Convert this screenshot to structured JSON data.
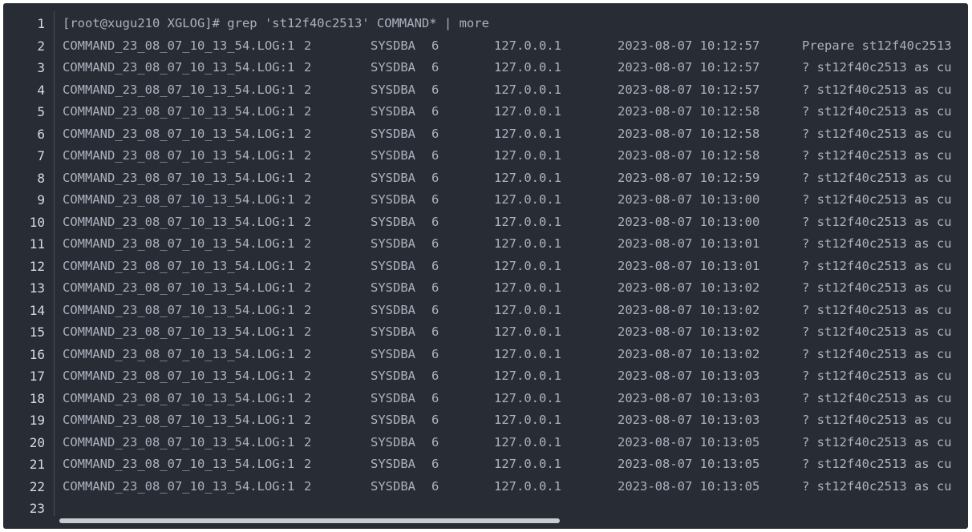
{
  "terminal": {
    "command": "[root@xugu210 XGLOG]# grep 'st12f40c2513' COMMAND* | more",
    "line_numbers": [
      "1",
      "2",
      "3",
      "4",
      "5",
      "6",
      "7",
      "8",
      "9",
      "10",
      "11",
      "12",
      "13",
      "14",
      "15",
      "16",
      "17",
      "18",
      "19",
      "20",
      "21",
      "22",
      "23"
    ],
    "rows": [
      {
        "file": "COMMAND_23_08_07_10_13_54.LOG:1",
        "num": "2",
        "user": "SYSDBA",
        "sess": "6",
        "ip": "127.0.0.1",
        "time": "2023-08-07 10:12:57",
        "sql": "Prepare st12f40c2513"
      },
      {
        "file": "COMMAND_23_08_07_10_13_54.LOG:1",
        "num": "2",
        "user": "SYSDBA",
        "sess": "6",
        "ip": "127.0.0.1",
        "time": "2023-08-07 10:12:57",
        "sql": "? st12f40c2513 as cu"
      },
      {
        "file": "COMMAND_23_08_07_10_13_54.LOG:1",
        "num": "2",
        "user": "SYSDBA",
        "sess": "6",
        "ip": "127.0.0.1",
        "time": "2023-08-07 10:12:57",
        "sql": "? st12f40c2513 as cu"
      },
      {
        "file": "COMMAND_23_08_07_10_13_54.LOG:1",
        "num": "2",
        "user": "SYSDBA",
        "sess": "6",
        "ip": "127.0.0.1",
        "time": "2023-08-07 10:12:58",
        "sql": "? st12f40c2513 as cu"
      },
      {
        "file": "COMMAND_23_08_07_10_13_54.LOG:1",
        "num": "2",
        "user": "SYSDBA",
        "sess": "6",
        "ip": "127.0.0.1",
        "time": "2023-08-07 10:12:58",
        "sql": "? st12f40c2513 as cu"
      },
      {
        "file": "COMMAND_23_08_07_10_13_54.LOG:1",
        "num": "2",
        "user": "SYSDBA",
        "sess": "6",
        "ip": "127.0.0.1",
        "time": "2023-08-07 10:12:58",
        "sql": "? st12f40c2513 as cu"
      },
      {
        "file": "COMMAND_23_08_07_10_13_54.LOG:1",
        "num": "2",
        "user": "SYSDBA",
        "sess": "6",
        "ip": "127.0.0.1",
        "time": "2023-08-07 10:12:59",
        "sql": "? st12f40c2513 as cu"
      },
      {
        "file": "COMMAND_23_08_07_10_13_54.LOG:1",
        "num": "2",
        "user": "SYSDBA",
        "sess": "6",
        "ip": "127.0.0.1",
        "time": "2023-08-07 10:13:00",
        "sql": "? st12f40c2513 as cu"
      },
      {
        "file": "COMMAND_23_08_07_10_13_54.LOG:1",
        "num": "2",
        "user": "SYSDBA",
        "sess": "6",
        "ip": "127.0.0.1",
        "time": "2023-08-07 10:13:00",
        "sql": "? st12f40c2513 as cu"
      },
      {
        "file": "COMMAND_23_08_07_10_13_54.LOG:1",
        "num": "2",
        "user": "SYSDBA",
        "sess": "6",
        "ip": "127.0.0.1",
        "time": "2023-08-07 10:13:01",
        "sql": "? st12f40c2513 as cu"
      },
      {
        "file": "COMMAND_23_08_07_10_13_54.LOG:1",
        "num": "2",
        "user": "SYSDBA",
        "sess": "6",
        "ip": "127.0.0.1",
        "time": "2023-08-07 10:13:01",
        "sql": "? st12f40c2513 as cu"
      },
      {
        "file": "COMMAND_23_08_07_10_13_54.LOG:1",
        "num": "2",
        "user": "SYSDBA",
        "sess": "6",
        "ip": "127.0.0.1",
        "time": "2023-08-07 10:13:02",
        "sql": "? st12f40c2513 as cu"
      },
      {
        "file": "COMMAND_23_08_07_10_13_54.LOG:1",
        "num": "2",
        "user": "SYSDBA",
        "sess": "6",
        "ip": "127.0.0.1",
        "time": "2023-08-07 10:13:02",
        "sql": "? st12f40c2513 as cu"
      },
      {
        "file": "COMMAND_23_08_07_10_13_54.LOG:1",
        "num": "2",
        "user": "SYSDBA",
        "sess": "6",
        "ip": "127.0.0.1",
        "time": "2023-08-07 10:13:02",
        "sql": "? st12f40c2513 as cu"
      },
      {
        "file": "COMMAND_23_08_07_10_13_54.LOG:1",
        "num": "2",
        "user": "SYSDBA",
        "sess": "6",
        "ip": "127.0.0.1",
        "time": "2023-08-07 10:13:02",
        "sql": "? st12f40c2513 as cu"
      },
      {
        "file": "COMMAND_23_08_07_10_13_54.LOG:1",
        "num": "2",
        "user": "SYSDBA",
        "sess": "6",
        "ip": "127.0.0.1",
        "time": "2023-08-07 10:13:03",
        "sql": "? st12f40c2513 as cu"
      },
      {
        "file": "COMMAND_23_08_07_10_13_54.LOG:1",
        "num": "2",
        "user": "SYSDBA",
        "sess": "6",
        "ip": "127.0.0.1",
        "time": "2023-08-07 10:13:03",
        "sql": "? st12f40c2513 as cu"
      },
      {
        "file": "COMMAND_23_08_07_10_13_54.LOG:1",
        "num": "2",
        "user": "SYSDBA",
        "sess": "6",
        "ip": "127.0.0.1",
        "time": "2023-08-07 10:13:03",
        "sql": "? st12f40c2513 as cu"
      },
      {
        "file": "COMMAND_23_08_07_10_13_54.LOG:1",
        "num": "2",
        "user": "SYSDBA",
        "sess": "6",
        "ip": "127.0.0.1",
        "time": "2023-08-07 10:13:05",
        "sql": "? st12f40c2513 as cu"
      },
      {
        "file": "COMMAND_23_08_07_10_13_54.LOG:1",
        "num": "2",
        "user": "SYSDBA",
        "sess": "6",
        "ip": "127.0.0.1",
        "time": "2023-08-07 10:13:05",
        "sql": "? st12f40c2513 as cu"
      },
      {
        "file": "COMMAND_23_08_07_10_13_54.LOG:1",
        "num": "2",
        "user": "SYSDBA",
        "sess": "6",
        "ip": "127.0.0.1",
        "time": "2023-08-07 10:13:05",
        "sql": "? st12f40c2513 as cu"
      }
    ]
  },
  "colors": {
    "background": "#282c34",
    "text": "#abb2bf",
    "line_number": "#d7dae0",
    "scrollbar_thumb": "#c9ccd1"
  }
}
